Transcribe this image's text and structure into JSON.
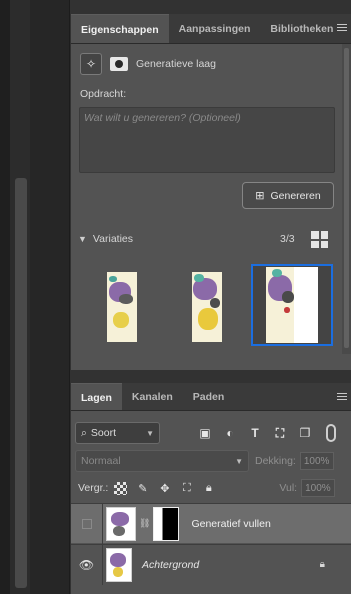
{
  "properties_tabs": [
    "Eigenschappen",
    "Aanpassingen",
    "Bibliotheken"
  ],
  "properties": {
    "layer_type_label": "Generatieve laag",
    "prompt_label": "Opdracht:",
    "prompt_placeholder": "Wat wilt u genereren? (Optioneel)",
    "generate_label": "Genereren",
    "variations_label": "Variaties",
    "variations_count": "3/3"
  },
  "layers_tabs": [
    "Lagen",
    "Kanalen",
    "Paden"
  ],
  "layers_panel": {
    "filter_select": "Soort",
    "blend_mode": "Normaal",
    "opacity_label": "Dekking:",
    "opacity_value": "100%",
    "lock_label": "Vergr.:",
    "fill_label": "Vul:",
    "fill_value": "100%"
  },
  "layers": [
    {
      "name": "Generatief vullen",
      "selected": true,
      "visible": false
    },
    {
      "name": "Achtergrond",
      "selected": false,
      "visible": true,
      "locked": true
    }
  ],
  "colors": {
    "selection_blue": "#1b6ee0",
    "panel_bg": "#535353"
  },
  "icons": [
    "star-wand-icon",
    "mask-icon",
    "generate-icon",
    "chevron-down-icon",
    "grid-view-icon",
    "search-icon",
    "image-filter-icon",
    "adjustment-filter-icon",
    "type-filter-icon",
    "shape-filter-icon",
    "smart-object-filter-icon",
    "lock-transparency-icon",
    "lock-brush-icon",
    "lock-move-icon",
    "lock-artboard-icon",
    "lock-all-icon",
    "eye-icon",
    "link-icon",
    "lock-icon",
    "panel-menu-icon"
  ]
}
